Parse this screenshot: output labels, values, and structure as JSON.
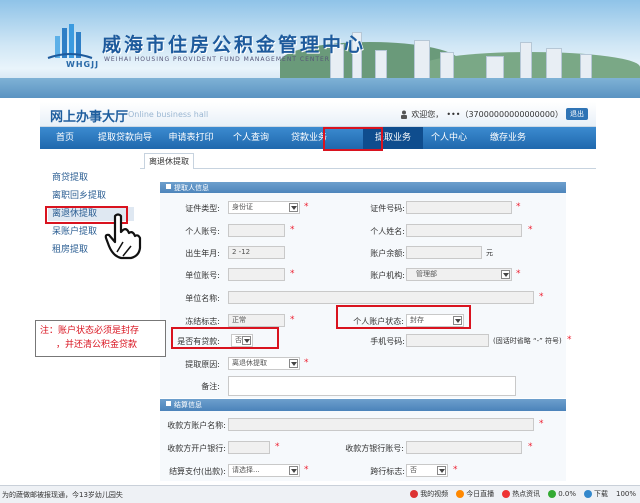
{
  "banner": {
    "title": "威海市住房公积金管理中心",
    "logo_text": "WHGJJ",
    "en_text": "WEIHAI HOUSING PROVIDENT FUND MANAGEMENT CENTER"
  },
  "header": {
    "hall_title": "网上办事大厅",
    "hall_en": "Online business hall",
    "welcome": "欢迎您，",
    "user_masked": "•••（37000000000000000）",
    "exit_label": "退出"
  },
  "nav": {
    "items": [
      {
        "label": "首页"
      },
      {
        "label": "提取贷款向导"
      },
      {
        "label": "申请表打印"
      },
      {
        "label": "个人查询"
      },
      {
        "label": "贷款业务"
      },
      {
        "label": "提取业务"
      },
      {
        "label": "个人中心"
      },
      {
        "label": "缴存业务"
      }
    ],
    "active_index": 5
  },
  "sidebar": {
    "items": [
      {
        "label": "商贷提取"
      },
      {
        "label": "离职回乡提取"
      },
      {
        "label": "离退休提取"
      },
      {
        "label": "呆账户提取"
      },
      {
        "label": "租房提取"
      }
    ],
    "selected_index": 2
  },
  "main": {
    "tab_label": "离退休提取",
    "section1_title": "提取人信息",
    "section2_title": "结算信息",
    "fields": {
      "id_type_label": "证件类型:",
      "id_type_value": "身份证",
      "id_no_label": "证件号码:",
      "personal_acct_label": "个人账号:",
      "personal_name_label": "个人姓名:",
      "birth_label": "出生年月:",
      "birth_value": "2    -12",
      "balance_label": "账户余额:",
      "balance_unit": "元",
      "unit_acct_label": "单位账号:",
      "acct_org_label": "账户机构:",
      "acct_org_value": "管理部",
      "unit_name_label": "单位名称:",
      "freeze_label": "冻结标志:",
      "freeze_value": "正常",
      "acct_status_label": "个人账户状态:",
      "acct_status_value": "封存",
      "has_loan_label": "是否有贷款:",
      "has_loan_value": "否",
      "mobile_label": "手机号码:",
      "mobile_hint": "(固话时省略 “-” 符号)",
      "reason_label": "提取原因:",
      "reason_value": "离退休提取",
      "remark_label": "备注:",
      "payee_name_label": "收款方账户名称:",
      "payee_bank_label": "收款方开户银行:",
      "payee_acct_label": "收款方银行账号:",
      "settle_method_label": "结算支付(出款):",
      "settle_method_value": "请选择...",
      "cross_bank_label": "跨行标志:",
      "cross_bank_value": "否"
    }
  },
  "note": {
    "line1": "注：账户状态必须是封存",
    "line2": "，并还清公积金贷款"
  },
  "taskbar": {
    "left_text": "为的蔬做邮被报现通，今13岁幼儿园失",
    "items": [
      "我的视频",
      "今日直播",
      "热点资讯",
      "0.0%",
      "下载",
      "100%"
    ]
  }
}
